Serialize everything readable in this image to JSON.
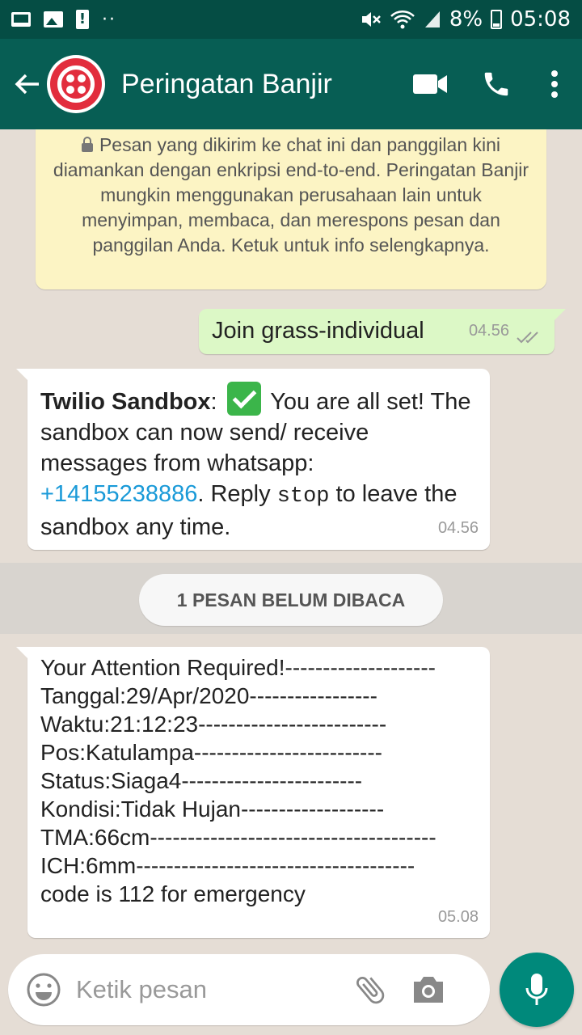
{
  "status_bar": {
    "battery": "8%",
    "time": "05:08",
    "icons": [
      "monitor-icon",
      "image-icon",
      "alert-icon",
      "more-dots-icon",
      "mute-icon",
      "wifi-icon",
      "signal-icon",
      "battery-icon"
    ]
  },
  "header": {
    "contact_name": "Peringatan Banjir",
    "icons": [
      "back-arrow-icon",
      "twilio-logo",
      "video-call-icon",
      "phone-icon",
      "more-vert-icon"
    ]
  },
  "encryption_notice": "Pesan yang dikirim ke chat ini dan panggilan kini diamankan dengan enkripsi end-to-end. Peringatan Banjir mungkin menggunakan perusahaan lain untuk menyimpan, membaca, dan merespons pesan dan panggilan Anda. Ketuk untuk info selengkapnya.",
  "messages": [
    {
      "direction": "outgoing",
      "text": "Join grass-individual",
      "time": "04.56"
    },
    {
      "direction": "incoming",
      "sender": "Twilio Sandbox",
      "sep": ":",
      "part1": " You are all set! The sandbox can now send/ receive messages from whatsapp: ",
      "phone": "+14155238886",
      "part2": ". Reply ",
      "code": "stop",
      "part3": " to leave the sandbox any time.",
      "time": "04.56"
    },
    {
      "direction": "incoming",
      "text": "Your Attention Required!--------------------\nTanggal:29/Apr/2020-----------------\nWaktu:21:12:23-------------------------\nPos:Katulampa-------------------------\nStatus:Siaga4------------------------\nKondisi:Tidak Hujan-------------------\nTMA:66cm--------------------------------------\nICH:6mm-------------------------------------\ncode is 112 for emergency",
      "time": "05.08"
    }
  ],
  "unread_label": "1 PESAN BELUM DIBACA",
  "input": {
    "placeholder": "Ketik pesan"
  },
  "colors": {
    "header": "#075e54",
    "status_bar": "#054d44",
    "outgoing_bubble": "#dcf8c6",
    "encryption_bg": "#fcf4c4",
    "mic_button": "#00897b",
    "link": "#1a9ad8"
  }
}
